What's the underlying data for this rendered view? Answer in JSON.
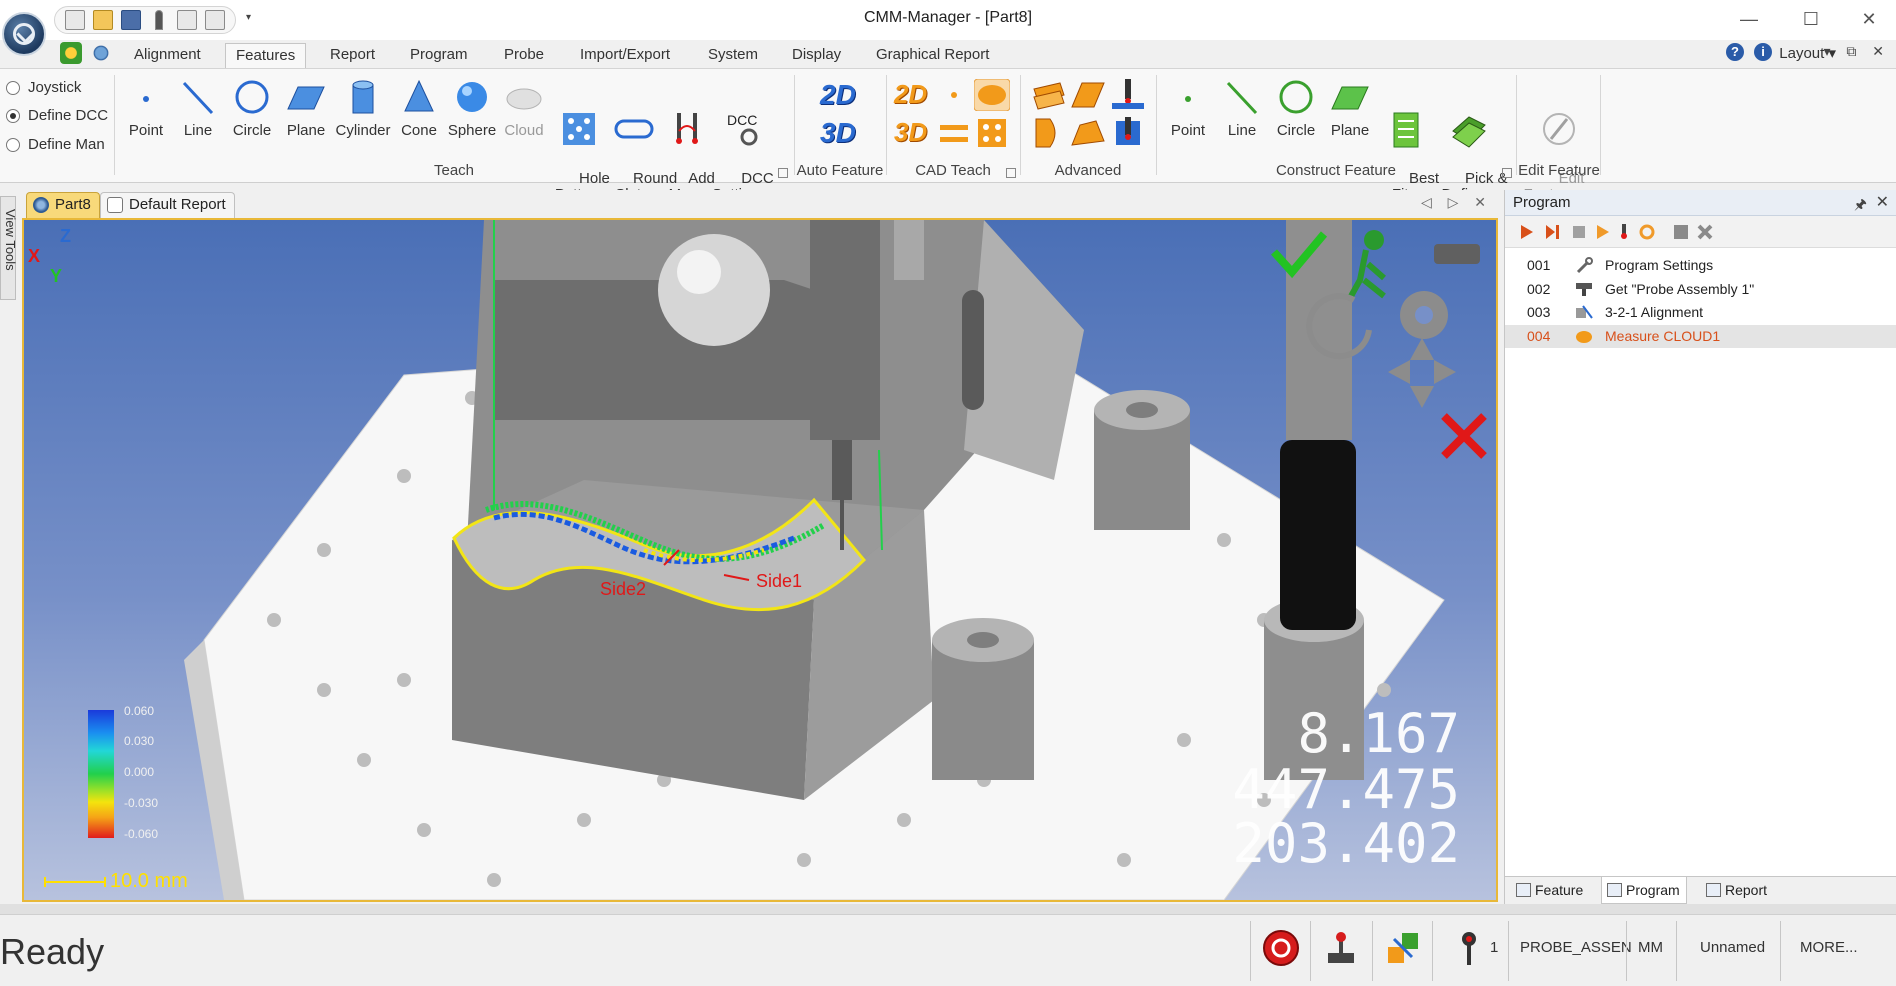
{
  "window": {
    "title": "CMM-Manager - [Part8]",
    "minimize": "—",
    "maximize": "☐",
    "close": "✕",
    "qat_dropdown": "▾"
  },
  "tabs": [
    "Alignment",
    "Features",
    "Report",
    "Program",
    "Probe",
    "Import/Export",
    "System",
    "Display",
    "Graphical Report"
  ],
  "active_tab": "Features",
  "layout_menu": "Layout ▾",
  "mdi_buttons": "▾ ⧉ ✕",
  "help_icon": "?",
  "info_icon": "i",
  "ribbon": {
    "mode_options": [
      {
        "label": "Joystick",
        "selected": false
      },
      {
        "label": "Define DCC",
        "selected": true
      },
      {
        "label": "Define Man",
        "selected": false
      }
    ],
    "teach": {
      "label": "Teach",
      "buttons": [
        {
          "label": "Point",
          "icon": "point-icon"
        },
        {
          "label": "Line",
          "icon": "line-icon"
        },
        {
          "label": "Circle",
          "icon": "circle-icon",
          "dropdown": true
        },
        {
          "label": "Plane",
          "icon": "plane-icon",
          "dropdown": true
        },
        {
          "label": "Cylinder",
          "icon": "cylinder-icon"
        },
        {
          "label": "Cone",
          "icon": "cone-icon"
        },
        {
          "label": "Sphere",
          "icon": "sphere-icon"
        },
        {
          "label": "Cloud",
          "icon": "cloud-icon",
          "disabled": true
        },
        {
          "label": "Hole\nPattern",
          "icon": "hole-pattern-icon"
        },
        {
          "label": "Round\nSlot ▾",
          "icon": "round-slot-icon"
        },
        {
          "label": "Add\nMove",
          "icon": "add-move-icon"
        },
        {
          "label": "DCC\nSettings...",
          "icon": "dcc-settings-icon"
        }
      ],
      "dcc_label": "DCC"
    },
    "auto_feature": {
      "label": "Auto Feature",
      "btn_2d": "2D",
      "btn_3d": "3D"
    },
    "cad_teach": {
      "label": "CAD Teach",
      "btn_2d": "2D",
      "btn_3d": "3D"
    },
    "advanced": {
      "label": "Advanced"
    },
    "construct": {
      "label": "Construct Feature",
      "buttons": [
        {
          "label": "Point"
        },
        {
          "label": "Line"
        },
        {
          "label": "Circle"
        },
        {
          "label": "Plane"
        },
        {
          "label": "Best\nFit ▾"
        },
        {
          "label": "Pick &\nDefine ▾"
        }
      ]
    },
    "edit": {
      "label": "Edit Feature",
      "button": "Edit\nFeatures ▾"
    },
    "launcher_glyph": "⊿"
  },
  "side_tab": "View Tools",
  "doc_tabs": [
    {
      "label": "Part8",
      "active": true
    },
    {
      "label": "Default Report",
      "active": false
    }
  ],
  "doc_nav": "◁ ▷ ✕",
  "viewport": {
    "annotations": [
      "Side2",
      "Side1"
    ],
    "axes": {
      "z": "Z",
      "x": "X",
      "y": "Y"
    },
    "legend_values": [
      "0.060",
      "0.030",
      "0.000",
      "-0.030",
      "-0.060"
    ],
    "scale": "10.0 mm",
    "dro": [
      "8.167",
      "447.475",
      "203.402"
    ],
    "colors": {
      "accent": "#e8b838",
      "ok": "#22c322",
      "cancel": "#e01818"
    }
  },
  "program_panel": {
    "title": "Program",
    "pin": "🖈",
    "close": "✕",
    "rows": [
      {
        "num": "001",
        "label": "Program Settings",
        "icon": "wrench-icon"
      },
      {
        "num": "002",
        "label": "Get \"Probe Assembly 1\"",
        "icon": "probe-assembly-icon"
      },
      {
        "num": "003",
        "label": "3-2-1 Alignment",
        "icon": "alignment-icon"
      },
      {
        "num": "004",
        "label": "Measure CLOUD1",
        "icon": "cloud-measure-icon",
        "selected": true
      }
    ],
    "bottom_tabs": [
      {
        "label": "Feature",
        "active": false
      },
      {
        "label": "Program",
        "active": true
      },
      {
        "label": "Report",
        "active": false
      }
    ]
  },
  "status": {
    "ready": "Ready",
    "probe_count": "1",
    "probe": "PROBE_ASSEN",
    "units": "MM",
    "name": "Unnamed",
    "more": "MORE..."
  }
}
